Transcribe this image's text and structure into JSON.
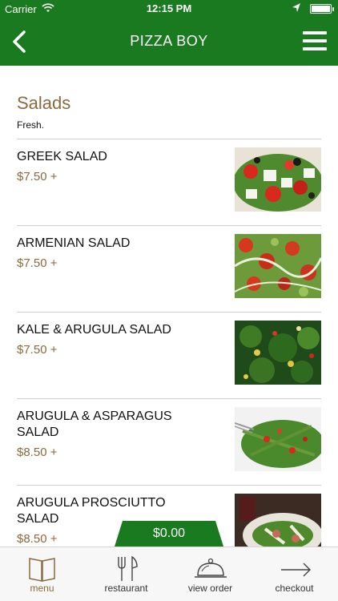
{
  "status_bar": {
    "carrier": "Carrier",
    "time": "12:15 PM"
  },
  "header": {
    "title": "PIZZA BOY",
    "back_icon": "chevron-left-icon",
    "menu_icon": "hamburger-menu-icon",
    "color": "#1a7a1f"
  },
  "section": {
    "title": "Salads",
    "subtitle": "Fresh."
  },
  "items": [
    {
      "name": "GREEK SALAD",
      "price": "$7.50 +"
    },
    {
      "name": "ARMENIAN SALAD",
      "price": "$7.50 +"
    },
    {
      "name": "KALE & ARUGULA SALAD",
      "price": "$7.50 +"
    },
    {
      "name": "ARUGULA & ASPARAGUS SALAD",
      "price": "$8.50 +"
    },
    {
      "name": "ARUGULA PROSCIUTTO SALAD",
      "price": "$8.50 +"
    }
  ],
  "cart": {
    "total": "$0.00"
  },
  "tabbar": {
    "tabs": [
      {
        "label": "menu",
        "icon": "book-icon",
        "active": true
      },
      {
        "label": "restaurant",
        "icon": "fork-knife-icon",
        "active": false
      },
      {
        "label": "view order",
        "icon": "cloche-icon",
        "active": false
      },
      {
        "label": "checkout",
        "icon": "arrow-right-icon",
        "active": false
      }
    ]
  },
  "colors": {
    "brand_green": "#1a7a1f",
    "accent_brown": "#8a6a3e"
  }
}
